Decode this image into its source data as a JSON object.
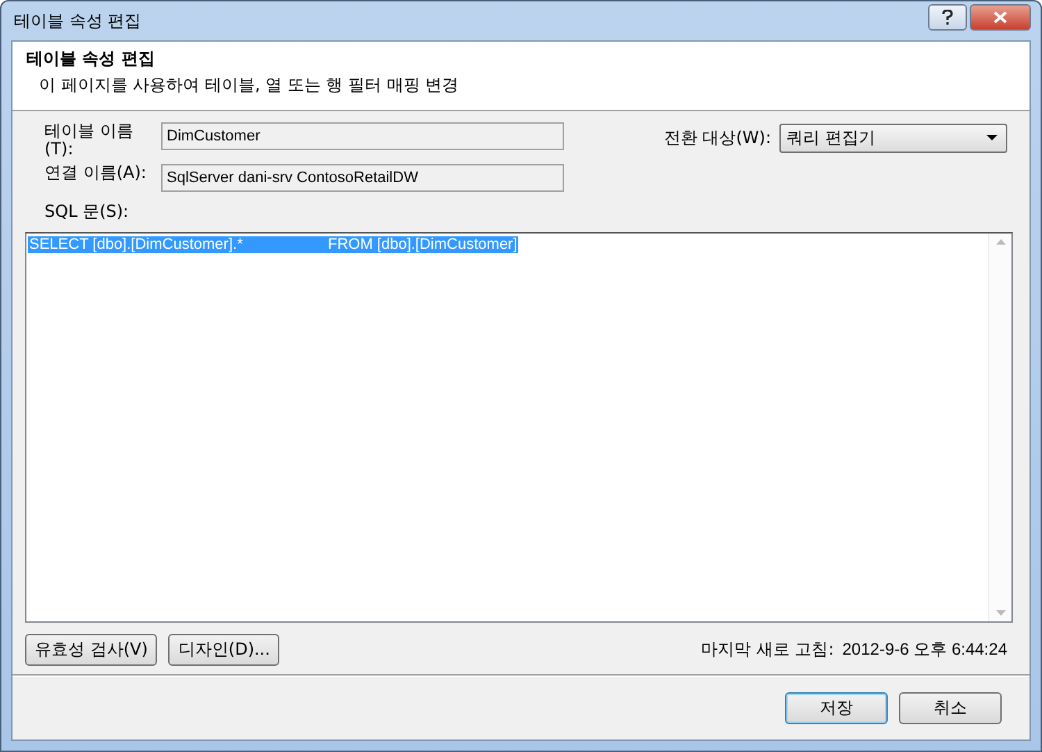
{
  "window": {
    "title": "테이블 속성 편집"
  },
  "header": {
    "title": "테이블 속성 편집",
    "subtitle": "이 페이지를 사용하여 테이블, 열 또는 행 필터 매핑 변경"
  },
  "table_name": {
    "label": "테이블 이름(T):",
    "value": "DimCustomer"
  },
  "switch_to": {
    "label": "전환 대상(W):",
    "value": "쿼리 편집기"
  },
  "connection_name": {
    "label": "연결 이름(A):",
    "value": "SqlServer dani-srv ContosoRetailDW"
  },
  "sql": {
    "label": "SQL 문(S):",
    "value": "SELECT [dbo].[DimCustomer].*                    FROM [dbo].[DimCustomer]",
    "selected": true
  },
  "actions": [
    {
      "label": "유효성 검사(V)"
    },
    {
      "label": "디자인(D)..."
    }
  ],
  "last_refresh": {
    "label": "마지막 새로 고침:",
    "value": "2012-9-6 오후 6:44:24"
  },
  "buttons": [
    {
      "label": "저장",
      "default": true
    },
    {
      "label": "취소",
      "default": false
    }
  ]
}
